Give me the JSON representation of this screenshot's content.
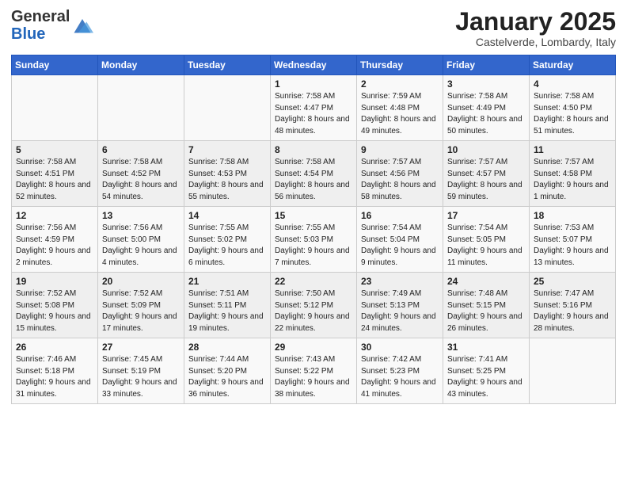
{
  "logo": {
    "general": "General",
    "blue": "Blue"
  },
  "title": "January 2025",
  "location": "Castelverde, Lombardy, Italy",
  "weekdays": [
    "Sunday",
    "Monday",
    "Tuesday",
    "Wednesday",
    "Thursday",
    "Friday",
    "Saturday"
  ],
  "weeks": [
    [
      {
        "day": "",
        "sunrise": "",
        "sunset": "",
        "daylight": ""
      },
      {
        "day": "",
        "sunrise": "",
        "sunset": "",
        "daylight": ""
      },
      {
        "day": "",
        "sunrise": "",
        "sunset": "",
        "daylight": ""
      },
      {
        "day": "1",
        "sunrise": "Sunrise: 7:58 AM",
        "sunset": "Sunset: 4:47 PM",
        "daylight": "Daylight: 8 hours and 48 minutes."
      },
      {
        "day": "2",
        "sunrise": "Sunrise: 7:59 AM",
        "sunset": "Sunset: 4:48 PM",
        "daylight": "Daylight: 8 hours and 49 minutes."
      },
      {
        "day": "3",
        "sunrise": "Sunrise: 7:58 AM",
        "sunset": "Sunset: 4:49 PM",
        "daylight": "Daylight: 8 hours and 50 minutes."
      },
      {
        "day": "4",
        "sunrise": "Sunrise: 7:58 AM",
        "sunset": "Sunset: 4:50 PM",
        "daylight": "Daylight: 8 hours and 51 minutes."
      }
    ],
    [
      {
        "day": "5",
        "sunrise": "Sunrise: 7:58 AM",
        "sunset": "Sunset: 4:51 PM",
        "daylight": "Daylight: 8 hours and 52 minutes."
      },
      {
        "day": "6",
        "sunrise": "Sunrise: 7:58 AM",
        "sunset": "Sunset: 4:52 PM",
        "daylight": "Daylight: 8 hours and 54 minutes."
      },
      {
        "day": "7",
        "sunrise": "Sunrise: 7:58 AM",
        "sunset": "Sunset: 4:53 PM",
        "daylight": "Daylight: 8 hours and 55 minutes."
      },
      {
        "day": "8",
        "sunrise": "Sunrise: 7:58 AM",
        "sunset": "Sunset: 4:54 PM",
        "daylight": "Daylight: 8 hours and 56 minutes."
      },
      {
        "day": "9",
        "sunrise": "Sunrise: 7:57 AM",
        "sunset": "Sunset: 4:56 PM",
        "daylight": "Daylight: 8 hours and 58 minutes."
      },
      {
        "day": "10",
        "sunrise": "Sunrise: 7:57 AM",
        "sunset": "Sunset: 4:57 PM",
        "daylight": "Daylight: 8 hours and 59 minutes."
      },
      {
        "day": "11",
        "sunrise": "Sunrise: 7:57 AM",
        "sunset": "Sunset: 4:58 PM",
        "daylight": "Daylight: 9 hours and 1 minute."
      }
    ],
    [
      {
        "day": "12",
        "sunrise": "Sunrise: 7:56 AM",
        "sunset": "Sunset: 4:59 PM",
        "daylight": "Daylight: 9 hours and 2 minutes."
      },
      {
        "day": "13",
        "sunrise": "Sunrise: 7:56 AM",
        "sunset": "Sunset: 5:00 PM",
        "daylight": "Daylight: 9 hours and 4 minutes."
      },
      {
        "day": "14",
        "sunrise": "Sunrise: 7:55 AM",
        "sunset": "Sunset: 5:02 PM",
        "daylight": "Daylight: 9 hours and 6 minutes."
      },
      {
        "day": "15",
        "sunrise": "Sunrise: 7:55 AM",
        "sunset": "Sunset: 5:03 PM",
        "daylight": "Daylight: 9 hours and 7 minutes."
      },
      {
        "day": "16",
        "sunrise": "Sunrise: 7:54 AM",
        "sunset": "Sunset: 5:04 PM",
        "daylight": "Daylight: 9 hours and 9 minutes."
      },
      {
        "day": "17",
        "sunrise": "Sunrise: 7:54 AM",
        "sunset": "Sunset: 5:05 PM",
        "daylight": "Daylight: 9 hours and 11 minutes."
      },
      {
        "day": "18",
        "sunrise": "Sunrise: 7:53 AM",
        "sunset": "Sunset: 5:07 PM",
        "daylight": "Daylight: 9 hours and 13 minutes."
      }
    ],
    [
      {
        "day": "19",
        "sunrise": "Sunrise: 7:52 AM",
        "sunset": "Sunset: 5:08 PM",
        "daylight": "Daylight: 9 hours and 15 minutes."
      },
      {
        "day": "20",
        "sunrise": "Sunrise: 7:52 AM",
        "sunset": "Sunset: 5:09 PM",
        "daylight": "Daylight: 9 hours and 17 minutes."
      },
      {
        "day": "21",
        "sunrise": "Sunrise: 7:51 AM",
        "sunset": "Sunset: 5:11 PM",
        "daylight": "Daylight: 9 hours and 19 minutes."
      },
      {
        "day": "22",
        "sunrise": "Sunrise: 7:50 AM",
        "sunset": "Sunset: 5:12 PM",
        "daylight": "Daylight: 9 hours and 22 minutes."
      },
      {
        "day": "23",
        "sunrise": "Sunrise: 7:49 AM",
        "sunset": "Sunset: 5:13 PM",
        "daylight": "Daylight: 9 hours and 24 minutes."
      },
      {
        "day": "24",
        "sunrise": "Sunrise: 7:48 AM",
        "sunset": "Sunset: 5:15 PM",
        "daylight": "Daylight: 9 hours and 26 minutes."
      },
      {
        "day": "25",
        "sunrise": "Sunrise: 7:47 AM",
        "sunset": "Sunset: 5:16 PM",
        "daylight": "Daylight: 9 hours and 28 minutes."
      }
    ],
    [
      {
        "day": "26",
        "sunrise": "Sunrise: 7:46 AM",
        "sunset": "Sunset: 5:18 PM",
        "daylight": "Daylight: 9 hours and 31 minutes."
      },
      {
        "day": "27",
        "sunrise": "Sunrise: 7:45 AM",
        "sunset": "Sunset: 5:19 PM",
        "daylight": "Daylight: 9 hours and 33 minutes."
      },
      {
        "day": "28",
        "sunrise": "Sunrise: 7:44 AM",
        "sunset": "Sunset: 5:20 PM",
        "daylight": "Daylight: 9 hours and 36 minutes."
      },
      {
        "day": "29",
        "sunrise": "Sunrise: 7:43 AM",
        "sunset": "Sunset: 5:22 PM",
        "daylight": "Daylight: 9 hours and 38 minutes."
      },
      {
        "day": "30",
        "sunrise": "Sunrise: 7:42 AM",
        "sunset": "Sunset: 5:23 PM",
        "daylight": "Daylight: 9 hours and 41 minutes."
      },
      {
        "day": "31",
        "sunrise": "Sunrise: 7:41 AM",
        "sunset": "Sunset: 5:25 PM",
        "daylight": "Daylight: 9 hours and 43 minutes."
      },
      {
        "day": "",
        "sunrise": "",
        "sunset": "",
        "daylight": ""
      }
    ]
  ]
}
